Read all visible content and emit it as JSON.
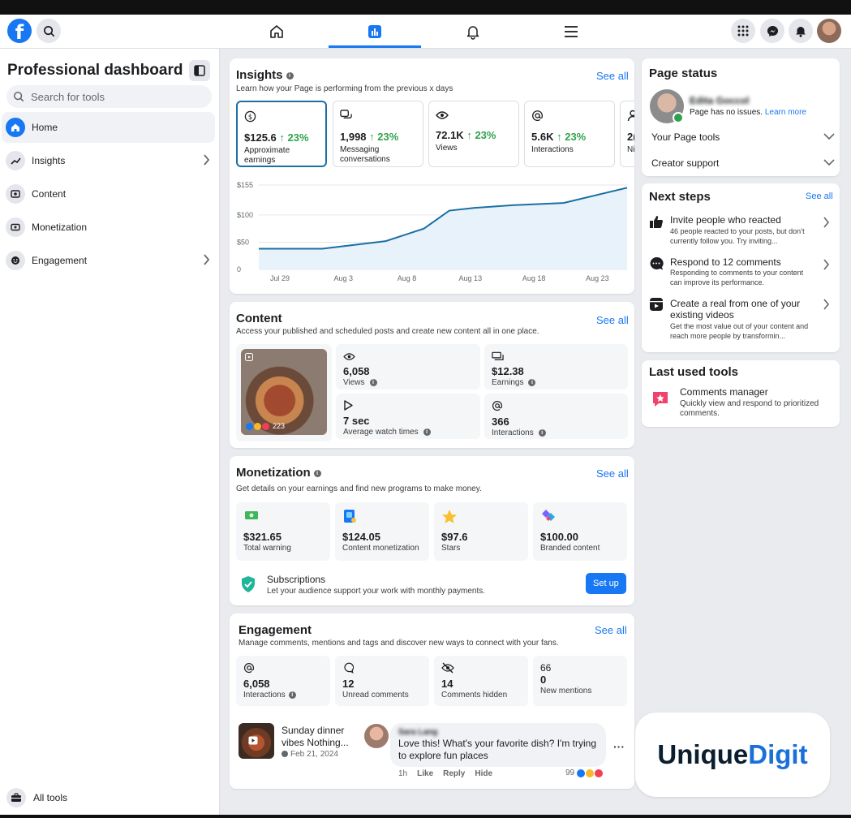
{
  "topnav": {
    "logo": "f"
  },
  "sidebar": {
    "title": "Professional dashboard",
    "search_placeholder": "Search for tools",
    "items": [
      {
        "label": "Home",
        "active": true
      },
      {
        "label": "Insights"
      },
      {
        "label": "Content"
      },
      {
        "label": "Monetization"
      },
      {
        "label": "Engagement"
      }
    ],
    "all_tools": "All tools"
  },
  "insights": {
    "title": "Insights",
    "subtitle": "Learn how your Page is performing from the previous x days",
    "see_all": "See all",
    "metrics": [
      {
        "value": "$125.6",
        "change": "23%",
        "label": "Approximate earnings"
      },
      {
        "value": "1,998",
        "change": "23%",
        "label": "Messaging conversations"
      },
      {
        "value": "72.1K",
        "change": "23%",
        "label": "Views"
      },
      {
        "value": "5.6K",
        "change": "23%",
        "label": "Interactions"
      },
      {
        "value": "2(",
        "label": "Ni"
      }
    ]
  },
  "chart_data": {
    "type": "area",
    "x_labels": [
      "Jul 29",
      "Aug 3",
      "Aug 8",
      "Aug 13",
      "Aug 18",
      "Aug 23"
    ],
    "y_tick_labels": [
      "$155",
      "$100",
      "$50",
      "0"
    ],
    "y_ticks": [
      155,
      100,
      50,
      0
    ],
    "ylim": [
      0,
      155
    ],
    "x": [
      0,
      5,
      10,
      13,
      15,
      17,
      20,
      24,
      29
    ],
    "values": [
      38,
      38,
      52,
      75,
      108,
      113,
      118,
      122,
      150
    ],
    "grid": true,
    "color": "#1a6fa3",
    "fill": "#e7f2fb"
  },
  "content": {
    "title": "Content",
    "subtitle": "Access your published and scheduled posts and create new content all in one place.",
    "see_all": "See all",
    "thumb_count": "223",
    "stats": [
      {
        "value": "6,058",
        "label": "Views"
      },
      {
        "value": "$12.38",
        "label": "Earnings"
      },
      {
        "value": "7 sec",
        "label": "Average watch times"
      },
      {
        "value": "366",
        "label": "Interactions"
      }
    ]
  },
  "monetization": {
    "title": "Monetization",
    "subtitle": "Get details on your earnings and find new programs to make money.",
    "see_all": "See all",
    "tiles": [
      {
        "value": "$321.65",
        "label": "Total warning"
      },
      {
        "value": "$124.05",
        "label": "Content monetization"
      },
      {
        "value": "$97.6",
        "label": "Stars"
      },
      {
        "value": "$100.00",
        "label": "Branded content"
      }
    ],
    "subscriptions_title": "Subscriptions",
    "subscriptions_desc": "Let your audience support your work with monthly payments.",
    "setup_label": "Set up"
  },
  "engagement": {
    "title": "Engagement",
    "subtitle": "Manage comments, mentions and tags and discover new ways to connect with your fans.",
    "see_all": "See all",
    "tiles": [
      {
        "top": "",
        "value": "6,058",
        "label": "Interactions"
      },
      {
        "top": "",
        "value": "12",
        "label": "Unread comments"
      },
      {
        "top": "",
        "value": "14",
        "label": "Comments hidden"
      },
      {
        "top": "66",
        "value": "0",
        "label": "New mentions"
      }
    ],
    "post_title_1": "Sunday dinner",
    "post_title_2": "vibes Nothing...",
    "post_date": "Feb 21, 2024",
    "commenter": "Sara Lang",
    "comment": "Love this! What's your favorite dish? I'm trying to explore fun places",
    "comment_time": "1h",
    "like": "Like",
    "reply": "Reply",
    "hide": "Hide",
    "reaction_count": "99"
  },
  "page_status": {
    "title": "Page status",
    "name": "Edita Goccol",
    "status_text": "Page has no issues.",
    "learn_more": "Learn more",
    "rows": [
      "Your Page tools",
      "Creator support"
    ]
  },
  "next_steps": {
    "title": "Next steps",
    "see_all": "See all",
    "items": [
      {
        "title": "Invite people who reacted",
        "desc": "46 people reacted to your posts, but don’t currently follow you. Try inviting..."
      },
      {
        "title": "Respond to 12 comments",
        "desc": "Responding to comments to your content can improve its performance."
      },
      {
        "title": "Create a real from one of your existing videos",
        "desc": "Get the most value out of your content and reach more people by transformin..."
      }
    ]
  },
  "last_used": {
    "title": "Last used tools",
    "tool_name": "Comments manager",
    "tool_desc": "Quickly view and respond to prioritized comments."
  },
  "watermark": {
    "part1": "Unique",
    "part2": "Digit"
  }
}
